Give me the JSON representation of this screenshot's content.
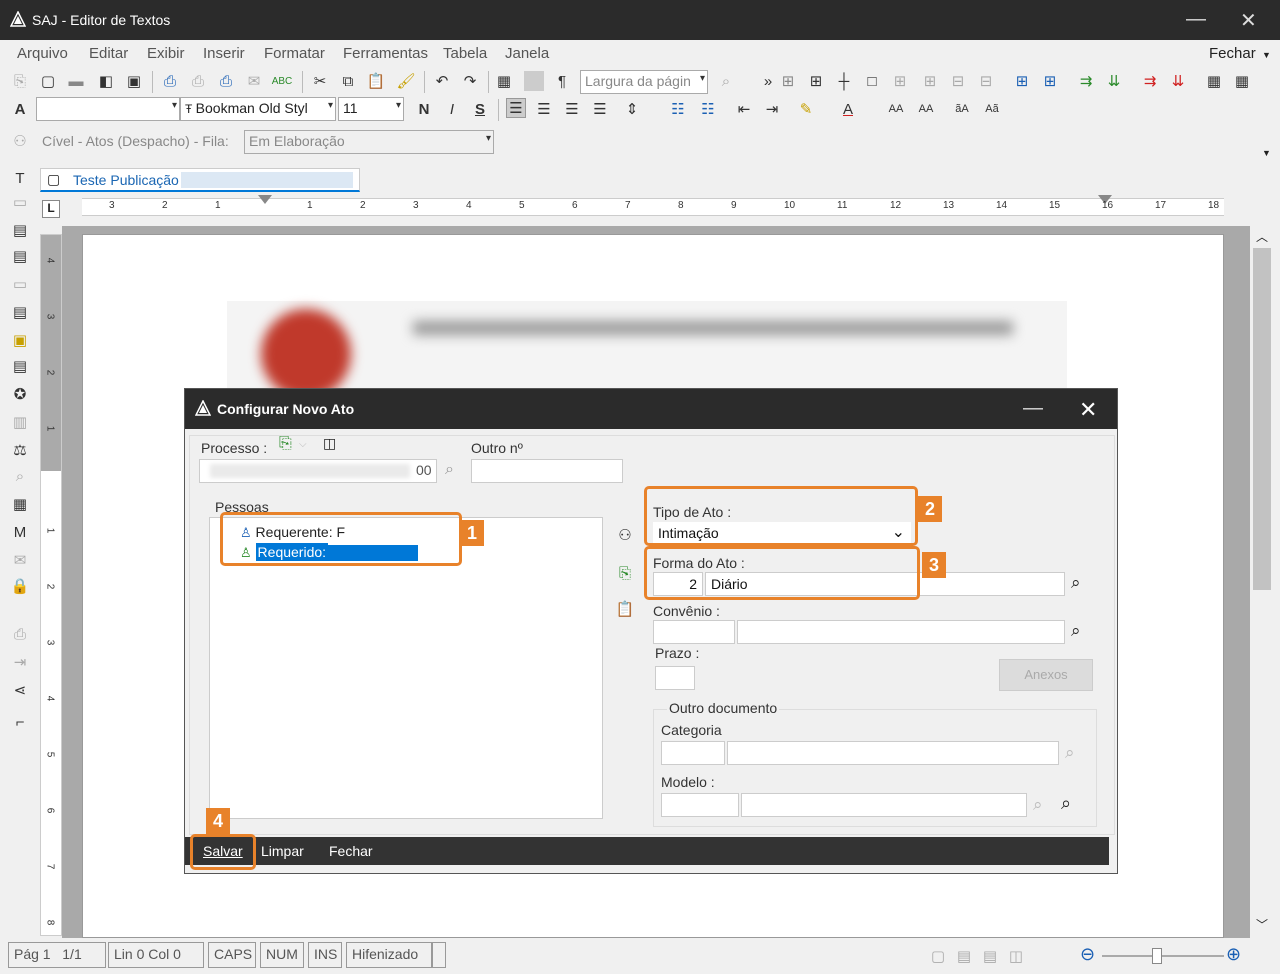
{
  "window": {
    "title": "SAJ - Editor de Textos",
    "minimize_glyph": "—",
    "close_glyph": "✕"
  },
  "menu": {
    "items": [
      "Arquivo",
      "Editar",
      "Exibir",
      "Inserir",
      "Formatar",
      "Ferramentas",
      "Tabela",
      "Janela"
    ],
    "fechar": "Fechar"
  },
  "toolbar": {
    "zoom_combo": "Largura da págin",
    "font_name": "Bookman Old Styl",
    "font_size": "11",
    "bold": "N",
    "italic": "I",
    "strike": "S"
  },
  "context": {
    "label": "Cível - Atos (Despacho) - Fila:",
    "queue": "Em Elaboração"
  },
  "document_tab": {
    "label": "Teste Publicação"
  },
  "ruler": {
    "numbers_left": [
      "3",
      "2",
      "1"
    ],
    "numbers_right": [
      "1",
      "2",
      "3",
      "4",
      "5",
      "6",
      "7",
      "8",
      "9",
      "10",
      "11",
      "12",
      "13",
      "14",
      "15",
      "16",
      "17",
      "18"
    ],
    "vertical": [
      "4",
      "3",
      "2",
      "1",
      "1",
      "2",
      "3",
      "4",
      "5",
      "6",
      "7",
      "8"
    ]
  },
  "dialog": {
    "title": "Configurar Novo Ato",
    "processo_label": "Processo :",
    "processo_value_suffix": "00",
    "outro_label": "Outro nº",
    "pessoas_label": "Pessoas",
    "people": [
      {
        "role": "Requerente:",
        "name": "F"
      },
      {
        "role": "Requerido:",
        "name": ""
      }
    ],
    "tipo_label": "Tipo de Ato :",
    "tipo_value": "Intimação",
    "forma_label": "Forma do Ato :",
    "forma_code": "2",
    "forma_value": "Diário",
    "convenio_label": "Convênio :",
    "prazo_label": "Prazo :",
    "anexos_label": "Anexos",
    "outro_doc_label": "Outro documento",
    "categoria_label": "Categoria",
    "modelo_label": "Modelo :",
    "buttons": {
      "salvar": "Salvar",
      "limpar": "Limpar",
      "fechar": "Fechar"
    },
    "minimize_glyph": "—",
    "close_glyph": "✕"
  },
  "annotations": [
    "1",
    "2",
    "3",
    "4"
  ],
  "status": {
    "pag": "Pág 1",
    "pages": "1/1",
    "lincol": "Lin 0  Col 0",
    "caps": "CAPS",
    "num": "NUM",
    "ins": "INS",
    "hifen": "Hifenizado"
  },
  "colors": {
    "accent": "#e8822a",
    "selection": "#0078d7",
    "titlebar": "#2b2b2b"
  }
}
